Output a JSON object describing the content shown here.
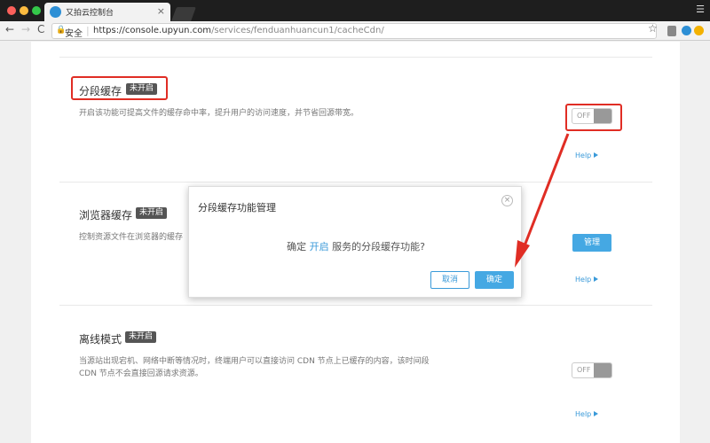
{
  "browser": {
    "tab_title": "又拍云控制台",
    "tab_close": "×",
    "menu_icon": "☰",
    "secure_label": "安全",
    "url_host": "https://console.upyun.com",
    "url_path": "/services/fenduanhuancun1/cacheCdn/",
    "lock_icon": "🔒",
    "star_icon": "☆",
    "back_icon": "←",
    "forward_icon": "→",
    "reload_icon": "C"
  },
  "sections": {
    "segment_cache": {
      "title": "分段缓存",
      "badge": "未开启",
      "desc": "开启该功能可提高文件的缓存命中率，提升用户的访问速度，并节省回源带宽。",
      "toggle_label": "OFF",
      "help": "Help"
    },
    "browser_cache": {
      "title": "浏览器缓存",
      "badge": "未开启",
      "desc": "控制资源文件在浏览器的缓存",
      "manage": "管理",
      "help": "Help"
    },
    "offline_mode": {
      "title": "离线模式",
      "badge": "未开启",
      "desc_line1": "当源站出现宕机、网络中断等情况时，终端用户可以直接访问 CDN 节点上已缓存的内容，该时间段",
      "desc_line2": "CDN 节点不会直接回源请求资源。",
      "toggle_label": "OFF",
      "help": "Help"
    }
  },
  "modal": {
    "title": "分段缓存功能管理",
    "close": "×",
    "msg_prefix": "确定 ",
    "msg_highlight": "开启",
    "msg_suffix": " 服务的分段缓存功能?",
    "cancel": "取消",
    "confirm": "确定"
  },
  "colors": {
    "annotation_red": "#e02d24",
    "accent_blue": "#45a8e3"
  }
}
